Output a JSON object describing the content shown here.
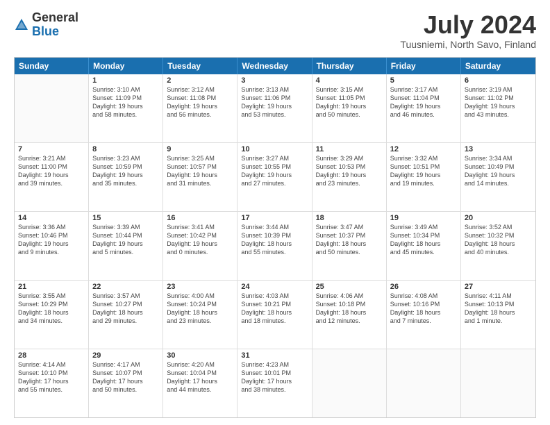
{
  "logo": {
    "general": "General",
    "blue": "Blue"
  },
  "title": "July 2024",
  "location": "Tuusniemi, North Savo, Finland",
  "header_days": [
    "Sunday",
    "Monday",
    "Tuesday",
    "Wednesday",
    "Thursday",
    "Friday",
    "Saturday"
  ],
  "weeks": [
    [
      {
        "day": "",
        "text": ""
      },
      {
        "day": "1",
        "text": "Sunrise: 3:10 AM\nSunset: 11:09 PM\nDaylight: 19 hours\nand 58 minutes."
      },
      {
        "day": "2",
        "text": "Sunrise: 3:12 AM\nSunset: 11:08 PM\nDaylight: 19 hours\nand 56 minutes."
      },
      {
        "day": "3",
        "text": "Sunrise: 3:13 AM\nSunset: 11:06 PM\nDaylight: 19 hours\nand 53 minutes."
      },
      {
        "day": "4",
        "text": "Sunrise: 3:15 AM\nSunset: 11:05 PM\nDaylight: 19 hours\nand 50 minutes."
      },
      {
        "day": "5",
        "text": "Sunrise: 3:17 AM\nSunset: 11:04 PM\nDaylight: 19 hours\nand 46 minutes."
      },
      {
        "day": "6",
        "text": "Sunrise: 3:19 AM\nSunset: 11:02 PM\nDaylight: 19 hours\nand 43 minutes."
      }
    ],
    [
      {
        "day": "7",
        "text": "Sunrise: 3:21 AM\nSunset: 11:00 PM\nDaylight: 19 hours\nand 39 minutes."
      },
      {
        "day": "8",
        "text": "Sunrise: 3:23 AM\nSunset: 10:59 PM\nDaylight: 19 hours\nand 35 minutes."
      },
      {
        "day": "9",
        "text": "Sunrise: 3:25 AM\nSunset: 10:57 PM\nDaylight: 19 hours\nand 31 minutes."
      },
      {
        "day": "10",
        "text": "Sunrise: 3:27 AM\nSunset: 10:55 PM\nDaylight: 19 hours\nand 27 minutes."
      },
      {
        "day": "11",
        "text": "Sunrise: 3:29 AM\nSunset: 10:53 PM\nDaylight: 19 hours\nand 23 minutes."
      },
      {
        "day": "12",
        "text": "Sunrise: 3:32 AM\nSunset: 10:51 PM\nDaylight: 19 hours\nand 19 minutes."
      },
      {
        "day": "13",
        "text": "Sunrise: 3:34 AM\nSunset: 10:49 PM\nDaylight: 19 hours\nand 14 minutes."
      }
    ],
    [
      {
        "day": "14",
        "text": "Sunrise: 3:36 AM\nSunset: 10:46 PM\nDaylight: 19 hours\nand 9 minutes."
      },
      {
        "day": "15",
        "text": "Sunrise: 3:39 AM\nSunset: 10:44 PM\nDaylight: 19 hours\nand 5 minutes."
      },
      {
        "day": "16",
        "text": "Sunrise: 3:41 AM\nSunset: 10:42 PM\nDaylight: 19 hours\nand 0 minutes."
      },
      {
        "day": "17",
        "text": "Sunrise: 3:44 AM\nSunset: 10:39 PM\nDaylight: 18 hours\nand 55 minutes."
      },
      {
        "day": "18",
        "text": "Sunrise: 3:47 AM\nSunset: 10:37 PM\nDaylight: 18 hours\nand 50 minutes."
      },
      {
        "day": "19",
        "text": "Sunrise: 3:49 AM\nSunset: 10:34 PM\nDaylight: 18 hours\nand 45 minutes."
      },
      {
        "day": "20",
        "text": "Sunrise: 3:52 AM\nSunset: 10:32 PM\nDaylight: 18 hours\nand 40 minutes."
      }
    ],
    [
      {
        "day": "21",
        "text": "Sunrise: 3:55 AM\nSunset: 10:29 PM\nDaylight: 18 hours\nand 34 minutes."
      },
      {
        "day": "22",
        "text": "Sunrise: 3:57 AM\nSunset: 10:27 PM\nDaylight: 18 hours\nand 29 minutes."
      },
      {
        "day": "23",
        "text": "Sunrise: 4:00 AM\nSunset: 10:24 PM\nDaylight: 18 hours\nand 23 minutes."
      },
      {
        "day": "24",
        "text": "Sunrise: 4:03 AM\nSunset: 10:21 PM\nDaylight: 18 hours\nand 18 minutes."
      },
      {
        "day": "25",
        "text": "Sunrise: 4:06 AM\nSunset: 10:18 PM\nDaylight: 18 hours\nand 12 minutes."
      },
      {
        "day": "26",
        "text": "Sunrise: 4:08 AM\nSunset: 10:16 PM\nDaylight: 18 hours\nand 7 minutes."
      },
      {
        "day": "27",
        "text": "Sunrise: 4:11 AM\nSunset: 10:13 PM\nDaylight: 18 hours\nand 1 minute."
      }
    ],
    [
      {
        "day": "28",
        "text": "Sunrise: 4:14 AM\nSunset: 10:10 PM\nDaylight: 17 hours\nand 55 minutes."
      },
      {
        "day": "29",
        "text": "Sunrise: 4:17 AM\nSunset: 10:07 PM\nDaylight: 17 hours\nand 50 minutes."
      },
      {
        "day": "30",
        "text": "Sunrise: 4:20 AM\nSunset: 10:04 PM\nDaylight: 17 hours\nand 44 minutes."
      },
      {
        "day": "31",
        "text": "Sunrise: 4:23 AM\nSunset: 10:01 PM\nDaylight: 17 hours\nand 38 minutes."
      },
      {
        "day": "",
        "text": ""
      },
      {
        "day": "",
        "text": ""
      },
      {
        "day": "",
        "text": ""
      }
    ]
  ]
}
